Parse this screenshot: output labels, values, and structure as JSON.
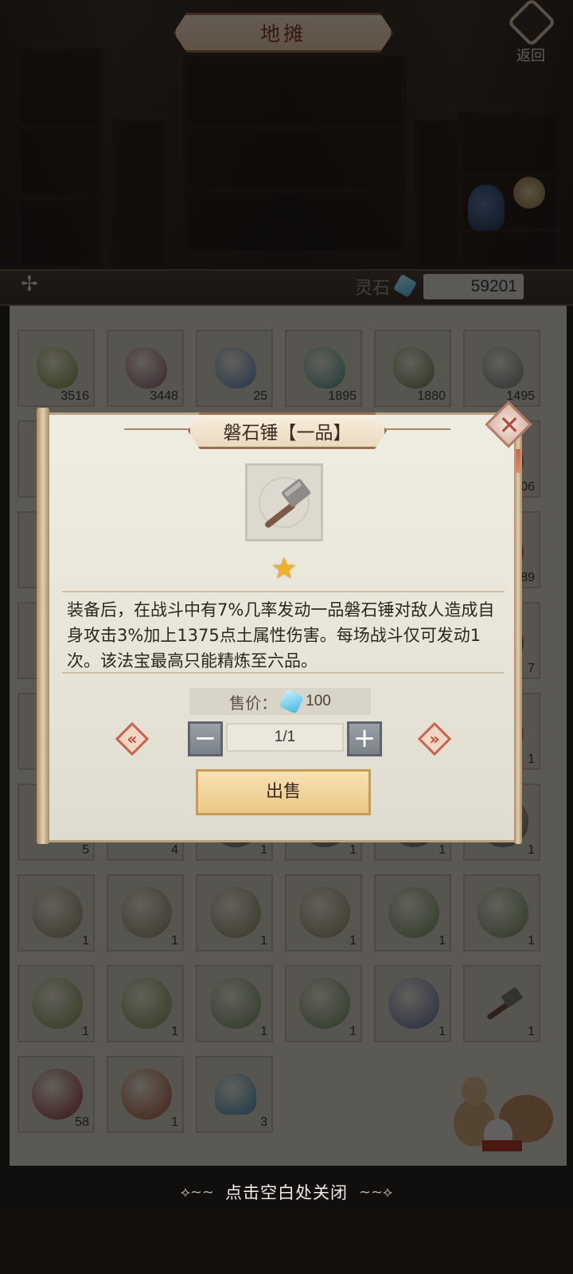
{
  "header": {
    "title": "地摊",
    "back_label": "返回"
  },
  "currency": {
    "label": "灵石",
    "value": "59201",
    "icon": "spirit-stone-icon",
    "color": "#4cb6e6"
  },
  "inventory": {
    "rows": [
      [
        {
          "icon": "herb-icon",
          "count": "3516",
          "color": "#7b8a3a"
        },
        {
          "icon": "herb-icon",
          "count": "3448",
          "color": "#8a5a6a"
        },
        {
          "icon": "flower-icon",
          "count": "25",
          "color": "#5a7fb3"
        },
        {
          "icon": "flower-icon",
          "count": "1895",
          "color": "#4d8f8a"
        },
        {
          "icon": "herb-icon",
          "count": "1880",
          "color": "#6a7a4a"
        },
        {
          "icon": "flower-icon",
          "count": "1495",
          "color": "#7a7a7a"
        }
      ],
      [
        {
          "icon": "herb-icon",
          "count": "",
          "color": "#6a5a3a"
        },
        {
          "icon": "herb-icon",
          "count": "",
          "color": "#6a5a3a"
        },
        {
          "icon": "herb-icon",
          "count": "",
          "color": "#6a5a3a"
        },
        {
          "icon": "herb-icon",
          "count": "",
          "color": "#6a5a3a"
        },
        {
          "icon": "herb-icon",
          "count": "",
          "color": "#6a5a3a"
        },
        {
          "icon": "herb-icon",
          "count": "06",
          "color": "#6a5a3a"
        }
      ],
      [
        {
          "icon": "herb-icon",
          "count": "",
          "color": "#5a5a5a"
        },
        {
          "icon": "herb-icon",
          "count": "",
          "color": "#5a5a5a"
        },
        {
          "icon": "herb-icon",
          "count": "",
          "color": "#5a5a5a"
        },
        {
          "icon": "herb-icon",
          "count": "",
          "color": "#5a5a5a"
        },
        {
          "icon": "herb-icon",
          "count": "",
          "color": "#5a5a5a"
        },
        {
          "icon": "herb-icon",
          "count": "89",
          "color": "#7a3a3a"
        }
      ],
      [
        {
          "icon": "herb-icon",
          "count": "",
          "color": "#5a5a5a"
        },
        {
          "icon": "herb-icon",
          "count": "",
          "color": "#5a5a5a"
        },
        {
          "icon": "herb-icon",
          "count": "",
          "color": "#5a5a5a"
        },
        {
          "icon": "herb-icon",
          "count": "",
          "color": "#5a5a5a"
        },
        {
          "icon": "herb-icon",
          "count": "",
          "color": "#5a5a5a"
        },
        {
          "icon": "herb-icon",
          "count": "7",
          "color": "#3a3a3a"
        }
      ],
      [
        {
          "icon": "herb-icon",
          "count": "",
          "color": "#5a5a5a"
        },
        {
          "icon": "herb-icon",
          "count": "",
          "color": "#5a5a5a"
        },
        {
          "icon": "herb-icon",
          "count": "",
          "color": "#5a5a5a"
        },
        {
          "icon": "herb-icon",
          "count": "",
          "color": "#5a5a5a"
        },
        {
          "icon": "herb-icon",
          "count": "",
          "color": "#5a5a5a"
        },
        {
          "icon": "herb-icon",
          "count": "1",
          "color": "#a04a4a"
        }
      ],
      [
        {
          "icon": "herb-icon",
          "count": "5",
          "color": "#3a4a6a"
        },
        {
          "icon": "herb-icon",
          "count": "4",
          "color": "#5a5a5a"
        },
        {
          "icon": "orb-icon",
          "count": "1",
          "color": "#5a5a5a"
        },
        {
          "icon": "orb-icon",
          "count": "1",
          "color": "#5a5a5a"
        },
        {
          "icon": "orb-icon",
          "count": "1",
          "color": "#5a5a5a"
        },
        {
          "icon": "orb-icon",
          "count": "1",
          "color": "#5a5a5a"
        }
      ],
      [
        {
          "icon": "orb-icon",
          "count": "1",
          "color": "#8a8060"
        },
        {
          "icon": "orb-icon",
          "count": "1",
          "color": "#8a8060"
        },
        {
          "icon": "orb-icon",
          "count": "1",
          "color": "#8a8060"
        },
        {
          "icon": "orb-icon",
          "count": "1",
          "color": "#8a8060"
        },
        {
          "icon": "orb-icon",
          "count": "1",
          "color": "#6a8a5a"
        },
        {
          "icon": "orb-icon",
          "count": "1",
          "color": "#6a8a5a"
        }
      ],
      [
        {
          "icon": "orb-icon",
          "count": "1",
          "color": "#7a8a4a"
        },
        {
          "icon": "orb-icon",
          "count": "1",
          "color": "#7a8a4a"
        },
        {
          "icon": "orb-icon",
          "count": "1",
          "color": "#6a8a5a"
        },
        {
          "icon": "orb-icon",
          "count": "1",
          "color": "#6a8a5a"
        },
        {
          "icon": "orb-icon",
          "count": "1",
          "color": "#5a6a9a"
        },
        {
          "icon": "hammer-icon",
          "count": "1",
          "color": "#6a5a50"
        }
      ],
      [
        {
          "icon": "orb-icon",
          "count": "58",
          "color": "#8a3030"
        },
        {
          "icon": "gourd-icon",
          "count": "1",
          "color": "#a05030"
        },
        {
          "icon": "cloud-icon",
          "count": "3",
          "color": "#4a8ab0"
        }
      ]
    ]
  },
  "dialog": {
    "title": "磐石锤【一品】",
    "item_icon": "hammer-icon",
    "star_count": 1,
    "star_color": "#f1b028",
    "description": "装备后，在战斗中有7%几率发动一品磐石锤对敌人造成自身攻击3%加上1375点土属性伤害。每场战斗仅可发动1次。该法宝最高只能精炼至六品。",
    "price_label": "售价：",
    "price_value": "100",
    "quantity": "1/1",
    "minus_label": "−",
    "plus_label": "+",
    "sell_label": "出售"
  },
  "footer": {
    "close_hint": "点击空白处关闭"
  }
}
